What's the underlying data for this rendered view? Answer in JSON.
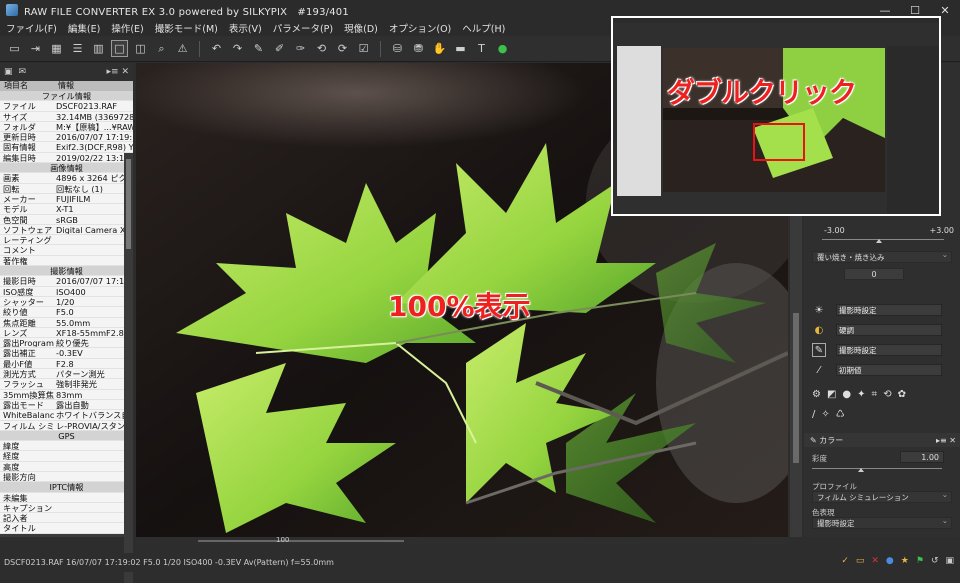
{
  "window": {
    "title": "RAW FILE CONVERTER EX 3.0 powered by SILKYPIX　#193/401",
    "controls": [
      "minimize",
      "maximize",
      "close"
    ]
  },
  "menu": [
    "ファイル(F)",
    "編集(E)",
    "操作(E)",
    "撮影モード(M)",
    "表示(V)",
    "パラメータ(P)",
    "現像(D)",
    "オプション(O)",
    "ヘルプ(H)"
  ],
  "toolbar": {
    "icons": [
      "open-folder-icon",
      "import-icon",
      "grid-view-icon",
      "list-view-icon",
      "split-view-icon",
      "single-view-icon",
      "compare-view-icon",
      "zoom-icon",
      "warning-icon",
      "undo-icon",
      "redo-icon",
      "dropper-icon",
      "dropper-plus-icon",
      "dropper-minus-icon",
      "rotate-left-icon",
      "rotate-right-icon",
      "check-icon",
      "develop-icon",
      "batch-develop-icon",
      "hand-icon",
      "screen-icon",
      "text-tool-icon",
      "status-ok-icon"
    ]
  },
  "info_panel": {
    "col_key": "項目名",
    "col_value": "情報",
    "rows": [
      {
        "type": "section",
        "k": "ファイル情報",
        "v": ""
      },
      {
        "type": "row",
        "k": "ファイル",
        "v": "DSCF0213.RAF"
      },
      {
        "type": "row",
        "k": "サイズ",
        "v": "32.14MB (3369728"
      },
      {
        "type": "row",
        "k": "フォルダ",
        "v": "M:¥【原稿】...¥RAW"
      },
      {
        "type": "row",
        "k": "更新日時",
        "v": "2016/07/07 17:19:"
      },
      {
        "type": "row",
        "k": "固有情報",
        "v": "Exif2.3(DCF,R98) Y"
      },
      {
        "type": "row",
        "k": "編集日時",
        "v": "2019/02/22 13:17:"
      },
      {
        "type": "section",
        "k": "画像情報",
        "v": ""
      },
      {
        "type": "row",
        "k": "画素",
        "v": "4896 x 3264 ピクセ"
      },
      {
        "type": "row",
        "k": "回転",
        "v": "回転なし (1)"
      },
      {
        "type": "row",
        "k": "メーカー",
        "v": "FUJIFILM"
      },
      {
        "type": "row",
        "k": "モデル",
        "v": "X-T1"
      },
      {
        "type": "row",
        "k": "色空間",
        "v": "sRGB"
      },
      {
        "type": "row",
        "k": "ソフトウェア",
        "v": "Digital Camera X-T"
      },
      {
        "type": "row",
        "k": "レーティング",
        "v": ""
      },
      {
        "type": "row",
        "k": "コメント",
        "v": ""
      },
      {
        "type": "row",
        "k": "著作権",
        "v": ""
      },
      {
        "type": "section",
        "k": "撮影情報",
        "v": ""
      },
      {
        "type": "row",
        "k": "撮影日時",
        "v": "2016/07/07 17:1"
      },
      {
        "type": "row",
        "k": "ISO感度",
        "v": "ISO400"
      },
      {
        "type": "row",
        "k": "シャッター",
        "v": "1/20"
      },
      {
        "type": "row",
        "k": "絞り値",
        "v": "F5.0"
      },
      {
        "type": "row",
        "k": "焦点距離",
        "v": "55.0mm"
      },
      {
        "type": "row",
        "k": "レンズ",
        "v": "XF18-55mmF2.8"
      },
      {
        "type": "row",
        "k": "露出Program",
        "v": "絞り優先"
      },
      {
        "type": "row",
        "k": "露出補正",
        "v": "-0.3EV"
      },
      {
        "type": "row",
        "k": "最小F値",
        "v": "F2.8"
      },
      {
        "type": "row",
        "k": "測光方式",
        "v": "パターン測光"
      },
      {
        "type": "row",
        "k": "フラッシュ",
        "v": "強制非発光"
      },
      {
        "type": "row",
        "k": "35mm換算焦",
        "v": "83mm"
      },
      {
        "type": "row",
        "k": "露出モード",
        "v": "露出自動"
      },
      {
        "type": "row",
        "k": "WhiteBalance",
        "v": "ホワイトバランス自動"
      },
      {
        "type": "row",
        "k": "フィルム シミュ",
        "v": "レ-PROVIA/スタンダード"
      },
      {
        "type": "section",
        "k": "GPS",
        "v": ""
      },
      {
        "type": "row",
        "k": "緯度",
        "v": ""
      },
      {
        "type": "row",
        "k": "経度",
        "v": ""
      },
      {
        "type": "row",
        "k": "高度",
        "v": ""
      },
      {
        "type": "row",
        "k": "撮影方向",
        "v": ""
      },
      {
        "type": "section",
        "k": "IPTC情報",
        "v": ""
      },
      {
        "type": "row",
        "k": "未編集",
        "v": ""
      },
      {
        "type": "row",
        "k": "キャプション",
        "v": ""
      },
      {
        "type": "row",
        "k": "記入者",
        "v": ""
      },
      {
        "type": "row",
        "k": "タイトル",
        "v": ""
      }
    ]
  },
  "viewer": {
    "overlay_text": "100%表示",
    "zoom": "100"
  },
  "inset": {
    "text": "ダブルクリック"
  },
  "right_panel": {
    "exposure_min": "-3.00",
    "exposure_max": "+3.00",
    "highlight_label": "覆い焼き・焼き込み",
    "highlight_value": "0",
    "wb_label": "撮影時設定",
    "tone_label": "硬調",
    "sharp_label": "撮影時設定",
    "noise_label": "初期値",
    "color_section": "カラー",
    "saturation_label": "彩度",
    "saturation_value": "1.00",
    "profile_label": "プロファイル",
    "profile_value": "フィルム シミュレーション",
    "color_expr_label": "色表現",
    "color_expr_value": "撮影時設定"
  },
  "status": {
    "text": "DSCF0213.RAF 16/07/07 17:19:02 F5.0 1/20 ISO400 -0.3EV Av(Pattern) f=55.0mm"
  }
}
